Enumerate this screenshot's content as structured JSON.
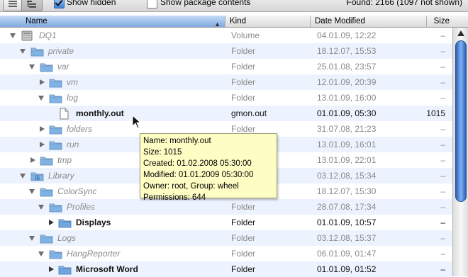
{
  "toolbar": {
    "show_hidden_label": "Show hidden",
    "show_hidden_checked": true,
    "show_package_label": "Show package contents",
    "show_package_checked": false,
    "found_text": "Found: 2166 (1097 not shown)"
  },
  "columns": {
    "name": "Name",
    "kind": "Kind",
    "date": "Date Modified",
    "size": "Size"
  },
  "rows": [
    {
      "name": "DQ1",
      "kind": "Volume",
      "date": "04.01.09, 12:22",
      "size": "–",
      "icon": "drive-icon",
      "expanded": true
    },
    {
      "name": "private",
      "kind": "Folder",
      "date": "18.12.07, 15:53",
      "size": "–",
      "icon": "folder-icon",
      "expanded": true
    },
    {
      "name": "var",
      "kind": "Folder",
      "date": "25.01.08, 23:57",
      "size": "–",
      "icon": "folder-icon",
      "expanded": true
    },
    {
      "name": "vm",
      "kind": "Folder",
      "date": "12.01.09, 20:39",
      "size": "–",
      "icon": "folder-icon",
      "expanded": false
    },
    {
      "name": "log",
      "kind": "Folder",
      "date": "13.01.09, 16:00",
      "size": "–",
      "icon": "folder-icon",
      "expanded": true
    },
    {
      "name": "monthly.out",
      "kind": "gmon.out",
      "date": "01.01.09, 05:30",
      "size": "1015",
      "icon": "document-icon"
    },
    {
      "name": "folders",
      "kind": "Folder",
      "date": "31.07.08, 21:23",
      "size": "–",
      "icon": "folder-icon",
      "expanded": false
    },
    {
      "name": "run",
      "kind": "Folder",
      "date": "13.01.09, 16:01",
      "size": "–",
      "icon": "folder-icon",
      "expanded": false
    },
    {
      "name": "tmp",
      "kind": "Folder",
      "date": "13.01.09, 22:01",
      "size": "–",
      "icon": "folder-icon",
      "expanded": false
    },
    {
      "name": "Library",
      "kind": "Folder",
      "date": "03.12.08, 15:34",
      "size": "–",
      "icon": "library-folder-icon",
      "expanded": true
    },
    {
      "name": "ColorSync",
      "kind": "Folder",
      "date": "18.12.07, 15:30",
      "size": "–",
      "icon": "folder-icon",
      "expanded": true
    },
    {
      "name": "Profiles",
      "kind": "Folder",
      "date": "28.07.08, 17:34",
      "size": "–",
      "icon": "folder-icon",
      "expanded": true
    },
    {
      "name": "Displays",
      "kind": "Folder",
      "date": "01.01.09, 10:57",
      "size": "–",
      "icon": "folder-icon",
      "expanded": false
    },
    {
      "name": "Logs",
      "kind": "Folder",
      "date": "03.12.08, 15:37",
      "size": "–",
      "icon": "folder-icon",
      "expanded": true
    },
    {
      "name": "HangReporter",
      "kind": "Folder",
      "date": "06.01.09, 01:47",
      "size": "–",
      "icon": "folder-icon",
      "expanded": true
    },
    {
      "name": "Microsoft Word",
      "kind": "Folder",
      "date": "01.01.09, 01:52",
      "size": "–",
      "icon": "folder-icon",
      "expanded": false
    }
  ],
  "tooltip": {
    "line1": "Name: monthly.out",
    "line2": "Size: 1015",
    "line3": "Created: 01.02.2008 05:30:00",
    "line4": "Modified: 01.01.2009 05:30:00",
    "line5": "Owner: root, Group: wheel",
    "line6": "Permissions: 644"
  },
  "colors": {
    "alt_row": "#edf3fe",
    "dim_text": "#8a8a8a",
    "tooltip_bg": "#fdfdc4",
    "folder_blue": "#7fb2e5",
    "scroll_thumb": "#3d7de0"
  }
}
